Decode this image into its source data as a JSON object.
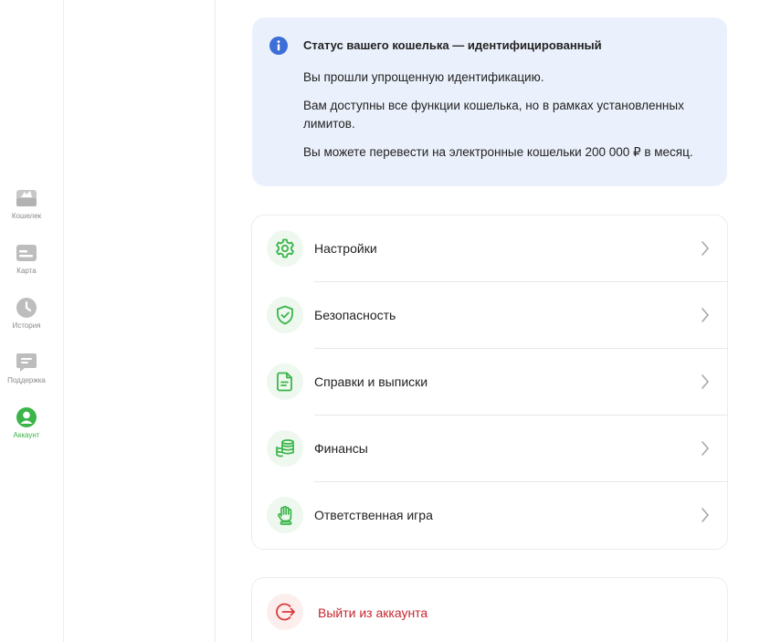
{
  "sidebar": {
    "items": [
      {
        "label": "Кошелек",
        "icon": "wallet-icon",
        "active": false
      },
      {
        "label": "Карта",
        "icon": "card-icon",
        "active": false
      },
      {
        "label": "История",
        "icon": "clock-icon",
        "active": false
      },
      {
        "label": "Поддержка",
        "icon": "chat-icon",
        "active": false
      },
      {
        "label": "Аккаунт",
        "icon": "user-icon",
        "active": true
      }
    ]
  },
  "status": {
    "icon": "info-icon",
    "title": "Статус вашего кошелька — идентифицированный",
    "lines": [
      "Вы прошли упрощенную идентификацию.",
      "Вам доступны все функции кошелька, но в рамках установленных лимитов.",
      "Вы можете перевести на электронные кошельки 200 000 ₽ в месяц."
    ]
  },
  "menu": {
    "items": [
      {
        "label": "Настройки",
        "icon": "gear-icon"
      },
      {
        "label": "Безопасность",
        "icon": "shield-check-icon"
      },
      {
        "label": "Справки и выписки",
        "icon": "document-icon"
      },
      {
        "label": "Финансы",
        "icon": "coins-icon"
      },
      {
        "label": "Ответственная игра",
        "icon": "hand-icon"
      }
    ]
  },
  "logout": {
    "label": "Выйти из аккаунта",
    "icon": "logout-icon"
  },
  "colors": {
    "accent": "#3bb54a",
    "danger": "#c6262e",
    "info_bg": "#ebf1fc",
    "info_icon": "#3d6fd8"
  }
}
